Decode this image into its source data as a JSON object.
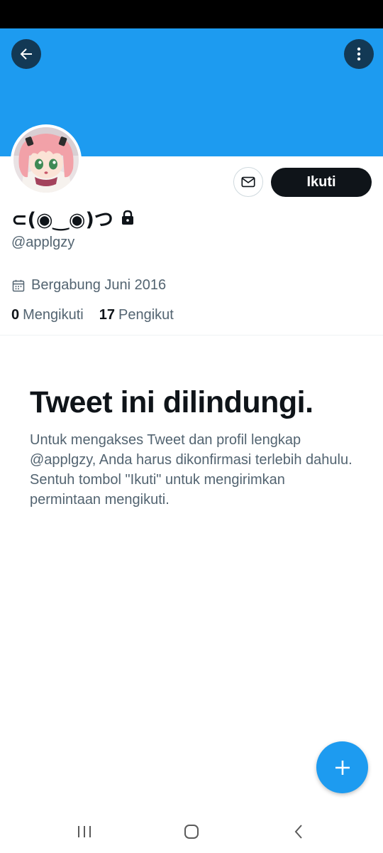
{
  "profile": {
    "display_name": "⊂(◉‿◉)つ",
    "handle": "@applgzy",
    "joined": "Bergabung Juni 2016",
    "following_count": "0",
    "following_label": "Mengikuti",
    "followers_count": "17",
    "followers_label": "Pengikut"
  },
  "actions": {
    "follow_label": "Ikuti"
  },
  "protected": {
    "title": "Tweet ini dilindungi.",
    "body": "Untuk mengakses Tweet dan profil lengkap @applgzy, Anda harus dikonfirmasi terlebih dahulu. Sentuh tombol \"Ikuti\" untuk mengirimkan permintaan mengikuti."
  },
  "icons": {
    "back": "arrow-left-icon",
    "more": "more-vertical-icon",
    "message": "envelope-icon",
    "lock": "lock-icon",
    "calendar": "calendar-icon",
    "compose": "plus-icon",
    "nav_recents": "recents-icon",
    "nav_home": "home-icon",
    "nav_back": "chevron-left-icon"
  },
  "colors": {
    "banner": "#1d9bf0",
    "accent": "#1d9bf0",
    "primary_text": "#0f1419",
    "secondary_text": "#536471",
    "follow_button": "#0f1419"
  }
}
